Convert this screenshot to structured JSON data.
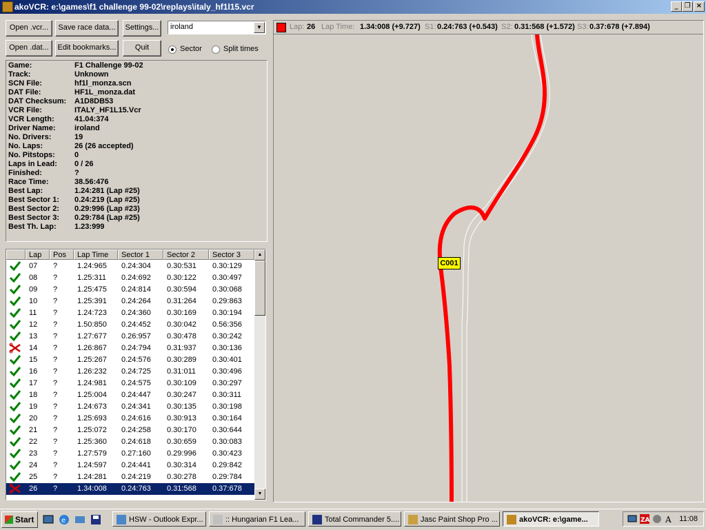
{
  "window": {
    "title": "akoVCR: e:\\games\\f1 challenge 99-02\\replays\\italy_hf1l15.vcr"
  },
  "buttons": {
    "open_vcr": "Open .vcr...",
    "save_race": "Save race data...",
    "settings": "Settings...",
    "open_dat": "Open .dat...",
    "edit_bookmarks": "Edit bookmarks...",
    "quit": "Quit"
  },
  "driver_select": {
    "value": "iroland"
  },
  "view_mode": {
    "sector_label": "Sector",
    "split_label": "Split times",
    "selected": "Sector"
  },
  "info": [
    {
      "k": "Game:",
      "v": "F1 Challenge 99-02"
    },
    {
      "k": "Track:",
      "v": "Unknown"
    },
    {
      "k": "SCN File:",
      "v": "hf1l_monza.scn"
    },
    {
      "k": "DAT File:",
      "v": "HF1L_monza.dat"
    },
    {
      "k": "DAT Checksum:",
      "v": "A1D8DB53"
    },
    {
      "k": "VCR File:",
      "v": "ITALY_HF1L15.Vcr"
    },
    {
      "k": "VCR Length:",
      "v": "41.04:374"
    },
    {
      "k": "Driver Name:",
      "v": "iroland"
    },
    {
      "k": "No. Drivers:",
      "v": "19"
    },
    {
      "k": "No. Laps:",
      "v": "26 (26 accepted)"
    },
    {
      "k": "No. Pitstops:",
      "v": "0"
    },
    {
      "k": "Laps in Lead:",
      "v": "0 / 26"
    },
    {
      "k": "Finished:",
      "v": "?"
    },
    {
      "k": "Race Time:",
      "v": "38.56:476"
    },
    {
      "k": "Best Lap:",
      "v": "1.24:281 (Lap #25)"
    },
    {
      "k": "Best Sector 1:",
      "v": "0.24:219 (Lap #25)"
    },
    {
      "k": "Best Sector 2:",
      "v": "0.29:996 (Lap #23)"
    },
    {
      "k": "Best Sector 3:",
      "v": "0.29:784 (Lap #25)"
    },
    {
      "k": "Best Th. Lap:",
      "v": "1.23:999"
    }
  ],
  "laps_table": {
    "columns": [
      "",
      "Lap",
      "Pos",
      "Lap Time",
      "Sector 1",
      "Sector 2",
      "Sector 3"
    ],
    "rows": [
      {
        "status": "ok",
        "lap": "07",
        "pos": "?",
        "time": "1.24:965",
        "s1": "0.24:304",
        "s2": "0.30:531",
        "s3": "0.30:129"
      },
      {
        "status": "ok",
        "lap": "08",
        "pos": "?",
        "time": "1.25:311",
        "s1": "0.24:692",
        "s2": "0.30:122",
        "s3": "0.30:497"
      },
      {
        "status": "ok",
        "lap": "09",
        "pos": "?",
        "time": "1.25:475",
        "s1": "0.24:814",
        "s2": "0.30:594",
        "s3": "0.30:068"
      },
      {
        "status": "ok",
        "lap": "10",
        "pos": "?",
        "time": "1.25:391",
        "s1": "0.24:264",
        "s2": "0.31:264",
        "s3": "0.29:863"
      },
      {
        "status": "ok",
        "lap": "11",
        "pos": "?",
        "time": "1.24:723",
        "s1": "0.24:360",
        "s2": "0.30:169",
        "s3": "0.30:194"
      },
      {
        "status": "ok",
        "lap": "12",
        "pos": "?",
        "time": "1.50:850",
        "s1": "0.24:452",
        "s2": "0.30:042",
        "s3": "0.56:356"
      },
      {
        "status": "ok",
        "lap": "13",
        "pos": "?",
        "time": "1.27:677",
        "s1": "0.26:957",
        "s2": "0.30:478",
        "s3": "0.30:242"
      },
      {
        "status": "cut",
        "lap": "14",
        "pos": "?",
        "time": "1.26:867",
        "s1": "0.24:794",
        "s2": "0.31:937",
        "s3": "0.30:136"
      },
      {
        "status": "ok",
        "lap": "15",
        "pos": "?",
        "time": "1.25:267",
        "s1": "0.24:576",
        "s2": "0.30:289",
        "s3": "0.30:401"
      },
      {
        "status": "ok",
        "lap": "16",
        "pos": "?",
        "time": "1.26:232",
        "s1": "0.24:725",
        "s2": "0.31:011",
        "s3": "0.30:496"
      },
      {
        "status": "ok",
        "lap": "17",
        "pos": "?",
        "time": "1.24:981",
        "s1": "0.24:575",
        "s2": "0.30:109",
        "s3": "0.30:297"
      },
      {
        "status": "ok",
        "lap": "18",
        "pos": "?",
        "time": "1.25:004",
        "s1": "0.24:447",
        "s2": "0.30:247",
        "s3": "0.30:311"
      },
      {
        "status": "ok",
        "lap": "19",
        "pos": "?",
        "time": "1.24:673",
        "s1": "0.24:341",
        "s2": "0.30:135",
        "s3": "0.30:198"
      },
      {
        "status": "ok",
        "lap": "20",
        "pos": "?",
        "time": "1.25:693",
        "s1": "0.24:616",
        "s2": "0.30:913",
        "s3": "0.30:164"
      },
      {
        "status": "ok",
        "lap": "21",
        "pos": "?",
        "time": "1.25:072",
        "s1": "0.24:258",
        "s2": "0.30:170",
        "s3": "0.30:644"
      },
      {
        "status": "ok",
        "lap": "22",
        "pos": "?",
        "time": "1.25:360",
        "s1": "0.24:618",
        "s2": "0.30:659",
        "s3": "0.30:083"
      },
      {
        "status": "ok",
        "lap": "23",
        "pos": "?",
        "time": "1.27:579",
        "s1": "0.27:160",
        "s2": "0.29:996",
        "s3": "0.30:423"
      },
      {
        "status": "ok",
        "lap": "24",
        "pos": "?",
        "time": "1.24:597",
        "s1": "0.24:441",
        "s2": "0.30:314",
        "s3": "0.29:842"
      },
      {
        "status": "ok",
        "lap": "25",
        "pos": "?",
        "time": "1.24:281",
        "s1": "0.24:219",
        "s2": "0.30:278",
        "s3": "0.29:784"
      },
      {
        "status": "cut",
        "lap": "26",
        "pos": "?",
        "time": "1.34:008",
        "s1": "0.24:763",
        "s2": "0.31:568",
        "s3": "0.37:678",
        "selected": true
      }
    ]
  },
  "lap_status": {
    "lap_label": "Lap:",
    "lap": "26",
    "laptime_label": "Lap Time:",
    "laptime": "1.34:008 (+9.727)",
    "s1_label": "S1:",
    "s1": "0.24:763 (+0.543)",
    "s2_label": "S2:",
    "s2": "0.31:568 (+1.572)",
    "s3_label": "S3:",
    "s3": "0.37:678 (+7.894)",
    "car_color": "#ff0000"
  },
  "car_marker": {
    "label": "C001"
  },
  "taskbar": {
    "start": "Start",
    "tasks": [
      {
        "label": "HSW - Outlook Expr...",
        "icon": "outlook-icon"
      },
      {
        "label": ":: Hungarian F1 Lea...",
        "icon": "ie-icon"
      },
      {
        "label": "Total Commander 5....",
        "icon": "floppy-icon"
      },
      {
        "label": "Jasc Paint Shop Pro ...",
        "icon": "paintshop-icon"
      },
      {
        "label": "akoVCR: e:\\game...",
        "icon": "akovcr-icon",
        "active": true
      }
    ],
    "clock": "11:08"
  },
  "colors": {
    "accent": "#0a246a",
    "track": "#ff0000",
    "ok": "#008000",
    "cut": "#cc0000"
  }
}
